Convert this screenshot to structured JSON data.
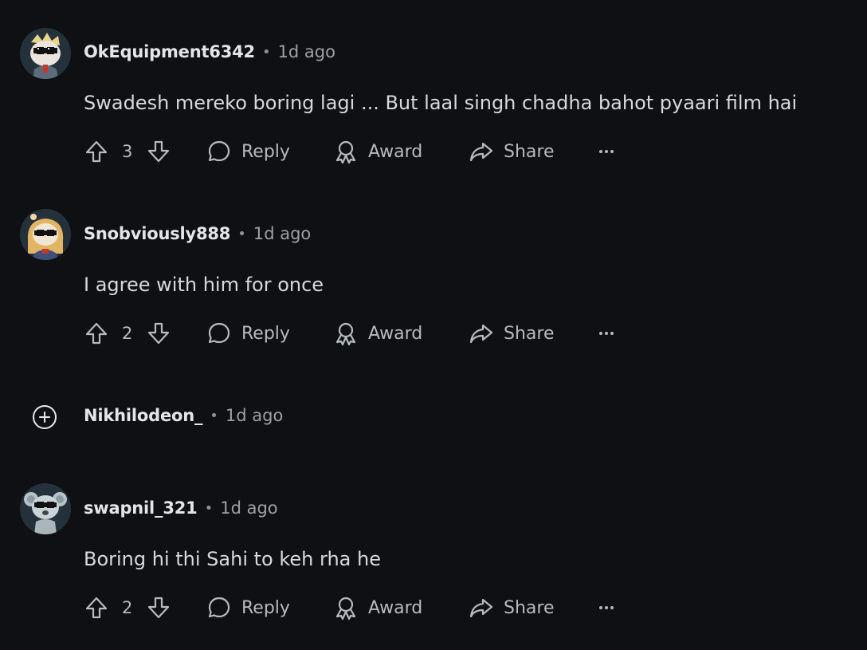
{
  "comments": [
    {
      "username": "OkEquipment6342",
      "time": "1d ago",
      "body": "Swadesh mereko boring lagi ... But laal singh chadha bahot pyaari film hai",
      "votes": "3",
      "avatar": "avatar-sunglasses-blonde"
    },
    {
      "username": "Snobviously888",
      "time": "1d ago",
      "body": "I agree with him for once",
      "votes": "2",
      "avatar": "avatar-sunglasses-longhair"
    },
    {
      "username": "Nikhilodeon_",
      "time": "1d ago",
      "collapsed": true,
      "expand_icon": "plus-circle-icon"
    },
    {
      "username": "swapnil_321",
      "time": "1d ago",
      "body": "Boring hi thi Sahi to keh rha he",
      "votes": "2",
      "avatar": "avatar-sunglasses-koala"
    }
  ],
  "actions": {
    "reply": "Reply",
    "award": "Award",
    "share": "Share"
  },
  "separator": "•",
  "colors": {
    "background": "#0f1014",
    "text": "#d7dadc",
    "muted": "#9ba1a6"
  }
}
